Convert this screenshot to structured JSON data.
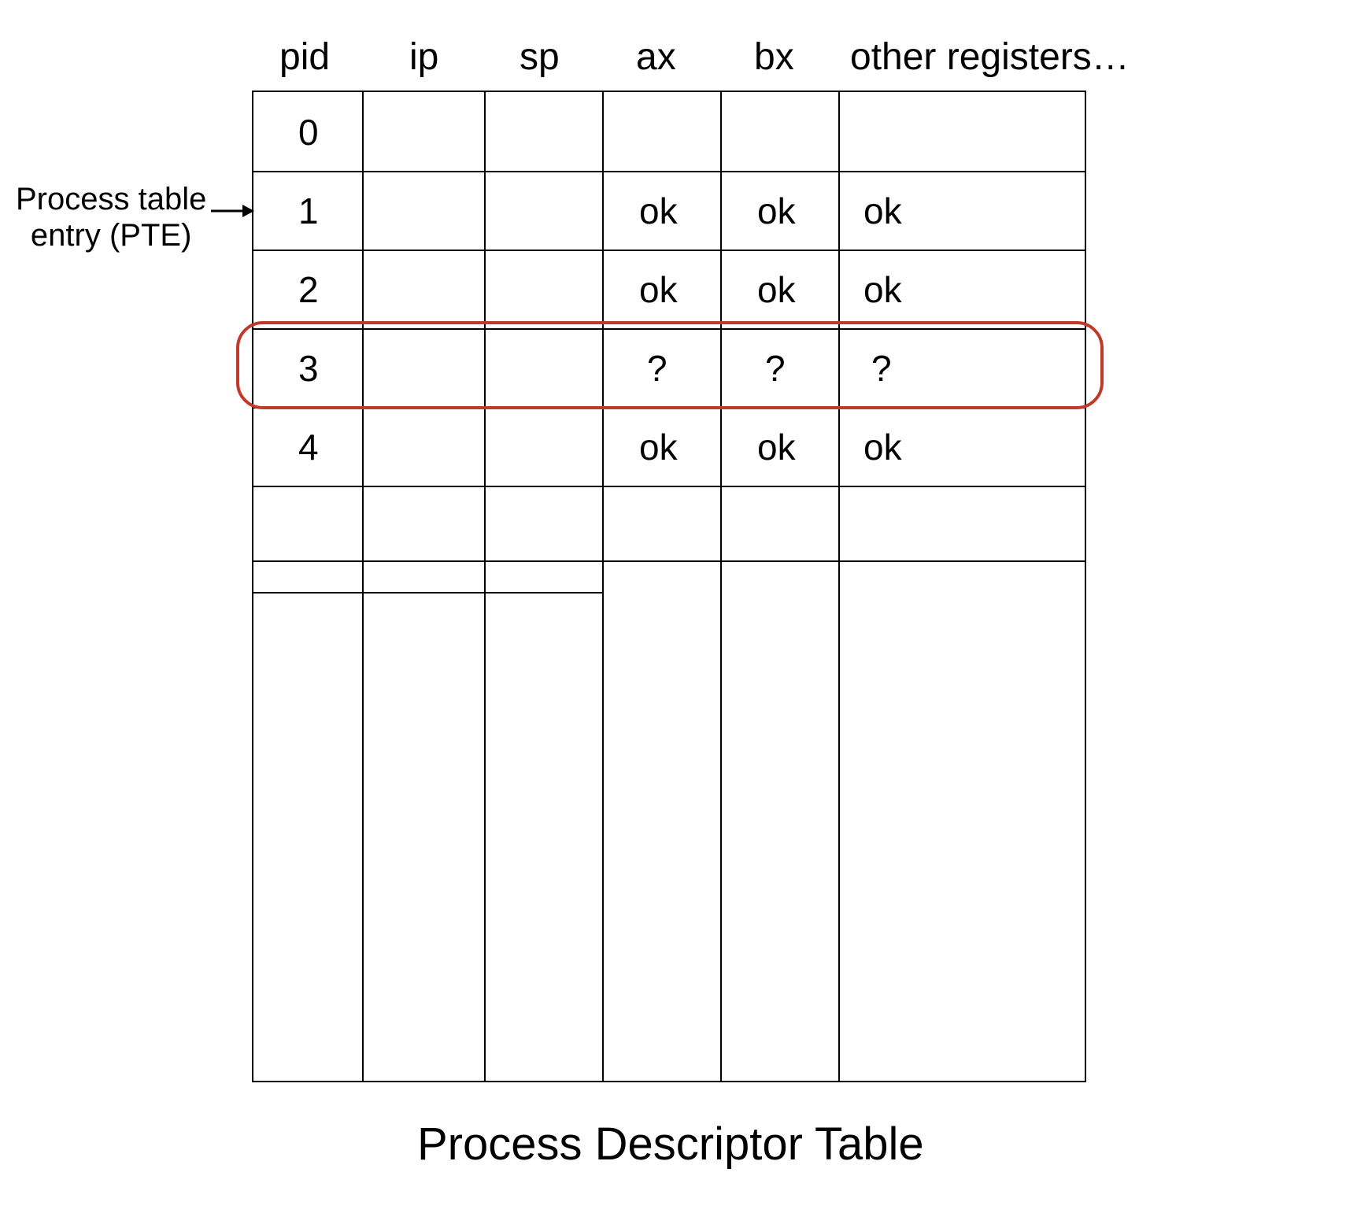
{
  "headers": {
    "pid": "pid",
    "ip": "ip",
    "sp": "sp",
    "ax": "ax",
    "bx": "bx",
    "other": "other registers…"
  },
  "rows": [
    {
      "pid": "0",
      "ip": "",
      "sp": "",
      "ax": "",
      "bx": "",
      "other": ""
    },
    {
      "pid": "1",
      "ip": "",
      "sp": "",
      "ax": "ok",
      "bx": "ok",
      "other": "ok"
    },
    {
      "pid": "2",
      "ip": "",
      "sp": "",
      "ax": "ok",
      "bx": "ok",
      "other": "ok"
    },
    {
      "pid": "3",
      "ip": "",
      "sp": "",
      "ax": "?",
      "bx": "?",
      "other": "?"
    },
    {
      "pid": "4",
      "ip": "",
      "sp": "",
      "ax": "ok",
      "bx": "ok",
      "other": "ok"
    }
  ],
  "highlighted_row_index": 3,
  "annotation": {
    "line1": "Process table",
    "line2": "entry (PTE)"
  },
  "caption": "Process Descriptor Table",
  "colors": {
    "highlight": "#c0392b"
  }
}
